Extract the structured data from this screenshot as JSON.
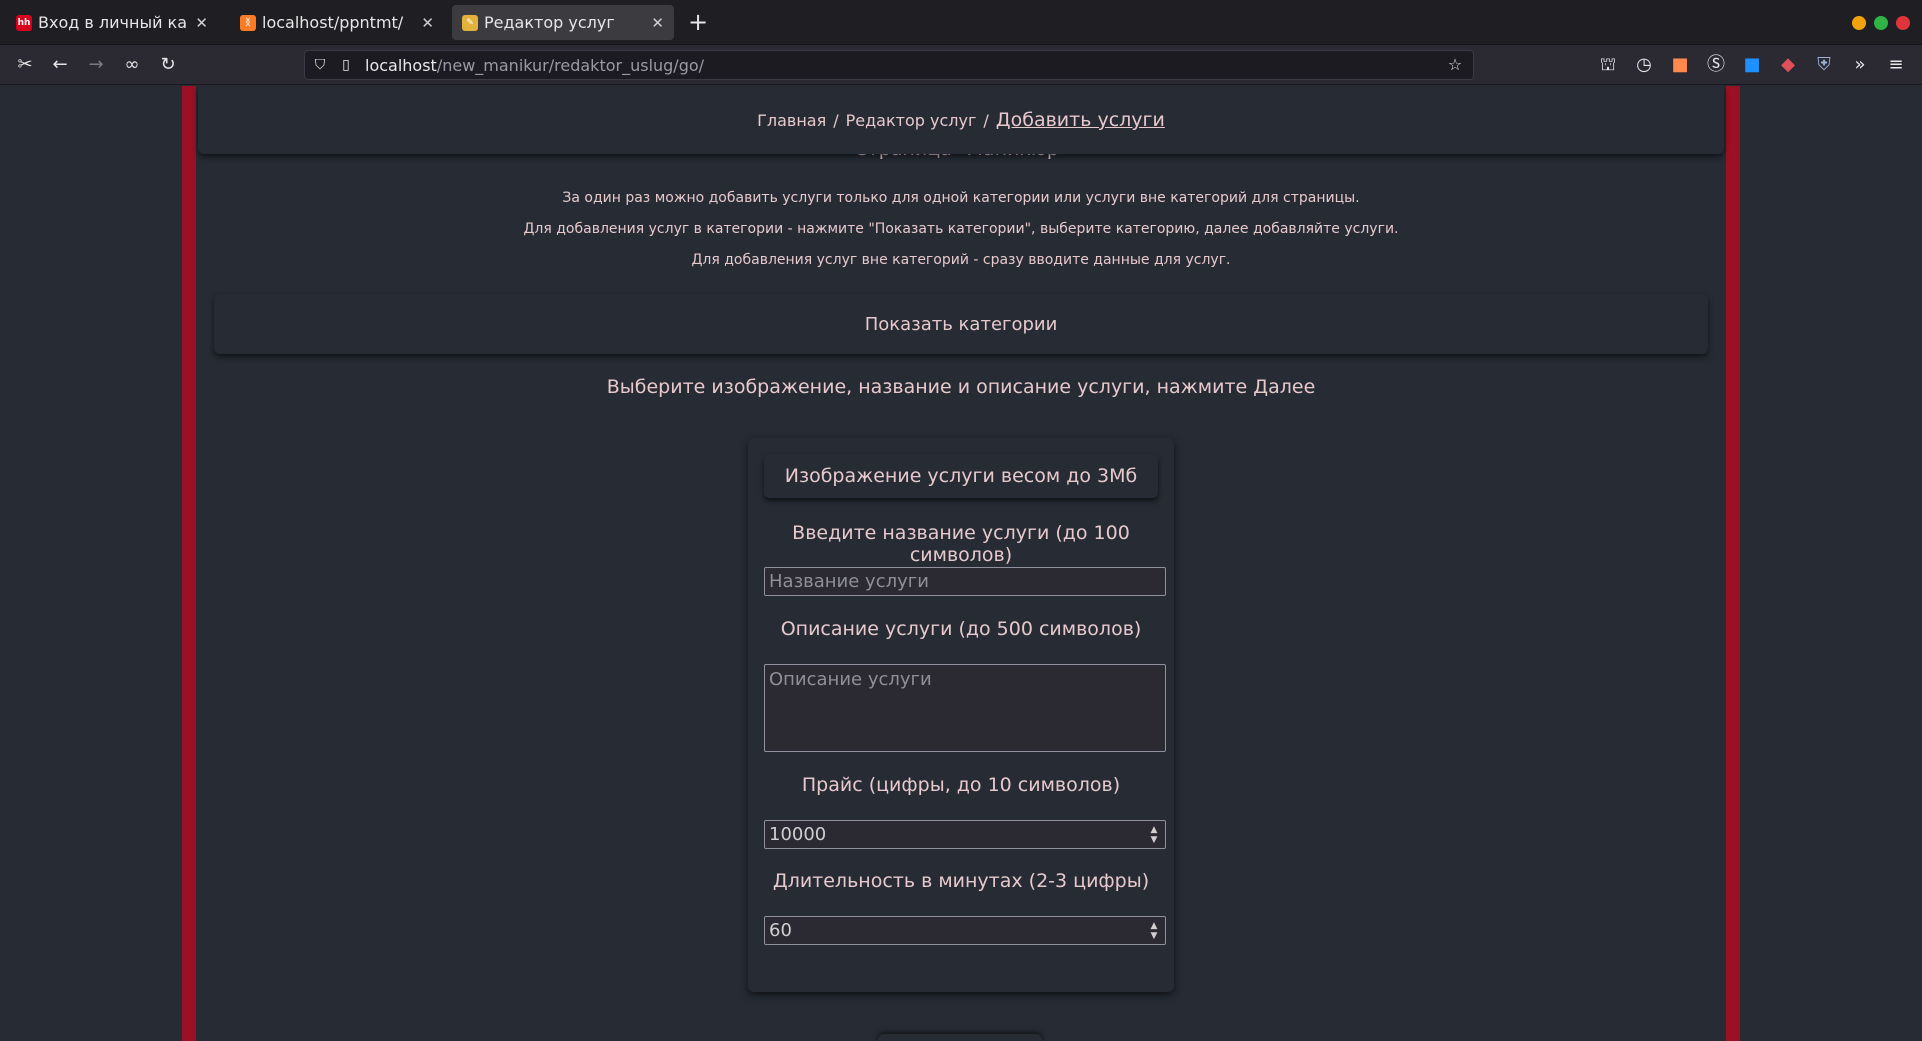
{
  "browser": {
    "tabs": [
      {
        "title": "Вход в личный кабинет",
        "favicon": "hh-favicon-icon",
        "favicon_color": "#d6001c",
        "active": false
      },
      {
        "title": "localhost/ppntmt/",
        "favicon": "xampp-favicon-icon",
        "favicon_color": "#fb7a24",
        "active": false
      },
      {
        "title": "Редактор услуг",
        "favicon": "brush-favicon-icon",
        "favicon_color": "#e2b23b",
        "active": true
      }
    ],
    "url_host": "localhost",
    "url_path": "/new_manikur/redaktor_uslug/go/"
  },
  "breadcrumb": {
    "home": "Главная",
    "editor": "Редактор услуг",
    "current": "Добавить услуги",
    "separator": "/"
  },
  "page_heading_partial": "Страница \"Маникюр\"",
  "info_lines": [
    "За один раз можно добавить услуги только для одной категории или услуги вне категорий для страницы.",
    "Для добавления услуг в категории - нажмите \"Показать категории\", выберите категорию, далее добавляйте услуги.",
    "Для добавления услуг вне категорий - сразу вводите данные для услуг."
  ],
  "show_categories_label": "Показать категории",
  "choose_text": "Выберите изображение, название и описание услуги, нажмите Далее",
  "form": {
    "image_button": "Изображение услуги весом до 3Мб",
    "name_label": "Введите название услуги (до 100 символов)",
    "name_placeholder": "Название услуги",
    "description_label": "Описание услуги (до 500 символов)",
    "description_placeholder": "Описание услуги",
    "price_label": "Прайс (цифры, до 10 символов)",
    "price_value": "10000",
    "duration_label": "Длительность в минутах (2-3 цифры)",
    "duration_value": "60"
  },
  "colors": {
    "accent_stripe": "#9b1024",
    "background": "#262b34",
    "text": "#e7c9cc"
  }
}
